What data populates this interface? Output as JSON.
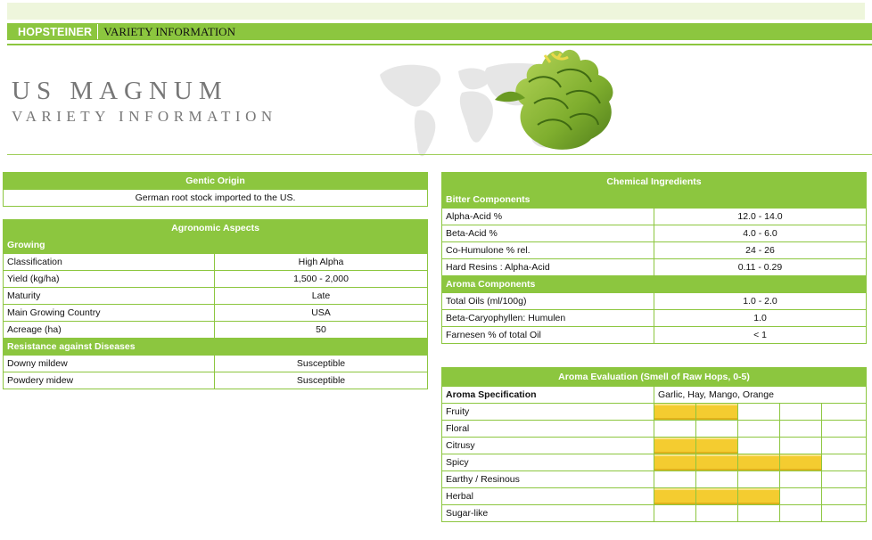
{
  "header": {
    "brand": "HOPSTEINER",
    "section": "VARIETY INFORMATION"
  },
  "hero": {
    "title": "US MAGNUM",
    "subtitle": "VARIETY INFORMATION"
  },
  "genetic_origin": {
    "heading": "Gentic Origin",
    "text": "German root stock imported to the US."
  },
  "agronomic": {
    "heading": "Agronomic Aspects",
    "growing_label": "Growing",
    "growing": [
      {
        "label": "Classification",
        "value": "High Alpha"
      },
      {
        "label": "Yield (kg/ha)",
        "value": "1,500 - 2,000"
      },
      {
        "label": "Maturity",
        "value": "Late"
      },
      {
        "label": "Main Growing Country",
        "value": "USA"
      },
      {
        "label": "Acreage (ha)",
        "value": "50"
      }
    ],
    "resistance_label": "Resistance against Diseases",
    "resistance": [
      {
        "label": "Downy mildew",
        "value": "Susceptible"
      },
      {
        "label": "Powdery midew",
        "value": "Susceptible"
      }
    ]
  },
  "chemical": {
    "heading": "Chemical Ingredients",
    "bitter_label": "Bitter Components",
    "bitter": [
      {
        "label": "Alpha-Acid %",
        "value": "12.0 - 14.0"
      },
      {
        "label": "Beta-Acid %",
        "value": "4.0 - 6.0"
      },
      {
        "label": "Co-Humulone % rel.",
        "value": "24 - 26"
      },
      {
        "label": "Hard Resins : Alpha-Acid",
        "value": "0.11 - 0.29"
      }
    ],
    "aroma_label": "Aroma Components",
    "aroma": [
      {
        "label": "Total Oils (ml/100g)",
        "value": "1.0 - 2.0"
      },
      {
        "label": "Beta-Caryophyllen: Humulen",
        "value": "1.0"
      },
      {
        "label": "Farnesen % of total Oil",
        "value": "< 1"
      }
    ]
  },
  "aroma_eval": {
    "heading": "Aroma Evaluation (Smell of Raw Hops, 0-5)",
    "spec_label": "Aroma Specification",
    "spec_value": "Garlic, Hay, Mango, Orange",
    "bar_color": "#f4cc30",
    "scale_max": 5,
    "rows": [
      {
        "label": "Fruity",
        "score": 2
      },
      {
        "label": "Floral",
        "score": 0
      },
      {
        "label": "Citrusy",
        "score": 2
      },
      {
        "label": "Spicy",
        "score": 4
      },
      {
        "label": "Earthy / Resinous",
        "score": 0
      },
      {
        "label": "Herbal",
        "score": 3
      },
      {
        "label": "Sugar-like",
        "score": 0
      }
    ]
  },
  "colors": {
    "accent": "#8cc63f",
    "light_band": "#eef6dc",
    "title_gray": "#777777"
  },
  "images": {
    "world_map": "world-map-watermark",
    "hop_cone": "hop-cone-image"
  }
}
